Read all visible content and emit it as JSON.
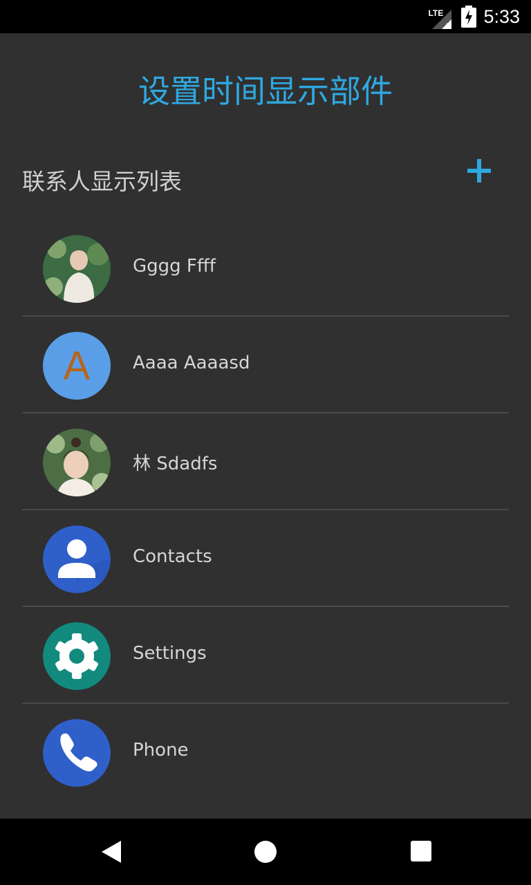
{
  "status_bar": {
    "network": "LTE",
    "time": "5:33"
  },
  "header": {
    "title": "设置时间显示部件"
  },
  "section": {
    "label": "联系人显示列表",
    "add_icon": "plus-icon"
  },
  "contacts": [
    {
      "name": "Gggg Ffff",
      "avatar": "photo",
      "avatar_colors": [
        "#2f5a3a",
        "#d9d3c4"
      ]
    },
    {
      "name": "Aaaa Aaaasd",
      "avatar": "letter",
      "letter": "A",
      "avatar_colors": [
        "#5b9ee8",
        "#b5651d"
      ]
    },
    {
      "name": "林 Sdadfs",
      "avatar": "photo",
      "avatar_colors": [
        "#4d6e45",
        "#e9d2c0"
      ]
    },
    {
      "name": "Contacts",
      "avatar": "contacts-app-icon",
      "avatar_colors": [
        "#2f5fc9"
      ]
    },
    {
      "name": "Settings",
      "avatar": "settings-app-icon",
      "avatar_colors": [
        "#128a7e"
      ]
    },
    {
      "name": "Phone",
      "avatar": "phone-app-icon",
      "avatar_colors": [
        "#2f5fc9"
      ]
    }
  ],
  "nav_bar": {
    "back": "back-icon",
    "home": "home-icon",
    "recents": "recents-icon"
  }
}
